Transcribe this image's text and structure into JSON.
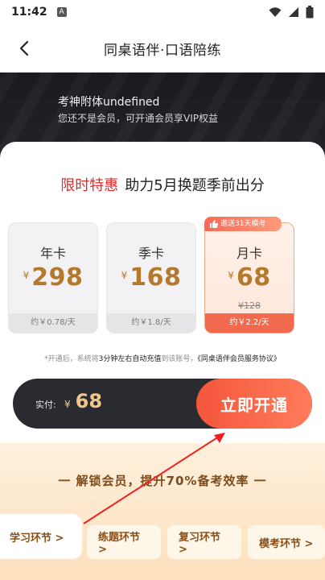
{
  "status": {
    "time": "11:42",
    "a_badge": "A"
  },
  "nav": {
    "title": "同桌语伴·口语陪练"
  },
  "hero": {
    "user_name": "考神附体undefined",
    "subtitle": "您还不是会员，可开通会员享VIP权益"
  },
  "promo": {
    "highlight": "限时特惠",
    "text": "助力5月换题季前出分"
  },
  "plans": [
    {
      "name": "年卡",
      "currency": "¥",
      "price": "298",
      "per_day": "约￥0.78/天"
    },
    {
      "name": "季卡",
      "currency": "¥",
      "price": "168",
      "per_day": "约￥1.8/天"
    },
    {
      "name": "月卡",
      "currency": "¥",
      "price": "68",
      "original": "¥128",
      "per_day": "约￥2.2/天",
      "badge": "邀送31天模考"
    }
  ],
  "agreement": {
    "prefix": "*开通后，系统将",
    "highlight": "3分钟左右自动充值",
    "middle": "到该账号，",
    "link": "《同桌语伴会员服务协议》"
  },
  "pay": {
    "label": "实付:",
    "currency": "¥",
    "amount": "68",
    "button": "立即开通"
  },
  "benefits": {
    "title": "一 解锁会员，提升70%备考效率 一",
    "tabs": [
      "学习环节 >",
      "练题环节 >",
      "复习环节 >",
      "模考环节 >"
    ]
  },
  "colors": {
    "accent": "#f4563c",
    "price": "#b4792d",
    "promo_red": "#e02b2b"
  }
}
